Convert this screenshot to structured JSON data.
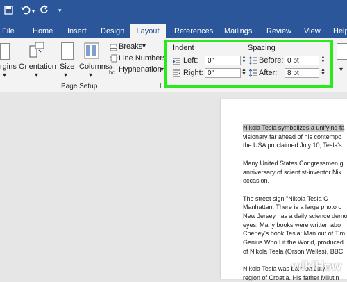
{
  "quick_access": {
    "save_icon": "save-icon",
    "undo_icon": "undo-icon",
    "redo_icon": "redo-icon"
  },
  "tabs": [
    "File",
    "Home",
    "Insert",
    "Design",
    "Layout",
    "References",
    "Mailings",
    "Review",
    "View",
    "Help"
  ],
  "ribbon": {
    "margins_label": "rgins",
    "orientation_label": "Orientation",
    "size_label": "Size",
    "columns_label": "Columns",
    "breaks": "Breaks",
    "line_numbers": "Line Numbers",
    "hyphenation": "Hyphenation",
    "group_page_setup": "Page Setup",
    "indent_header": "Indent",
    "spacing_header": "Spacing",
    "left_label": "Left:",
    "left_value": "0\"",
    "right_label": "Right:",
    "right_value": "0\"",
    "before_label": "Before:",
    "before_value": "0 pt",
    "after_label": "After:",
    "after_value": "8 pt"
  },
  "document": {
    "lines": [
      "Nikola Tesla symbolizes a unifying fa",
      "visionary far ahead of his contempo",
      "the USA proclaimed July 10, Tesla's",
      "",
      "Many United States Congressmen g",
      "anniversary of scientist-inventor Nik",
      "occasion.",
      "",
      "        The street sign \"Nikola Tesla C",
      "Manhattan. There is a large photo o",
      "New Jersey has a daily science demo",
      "eyes. Many books were written abo",
      "Cheney's book Tesla: Man out of Tim",
      "Genius Who Lit the World, produced",
      "of Nikola Tesla (Orson Welles), BBC",
      "",
      "        Nikola Tesla was born on July",
      "region of Croatia. His father Milutin"
    ]
  },
  "watermark": "wikiHow"
}
